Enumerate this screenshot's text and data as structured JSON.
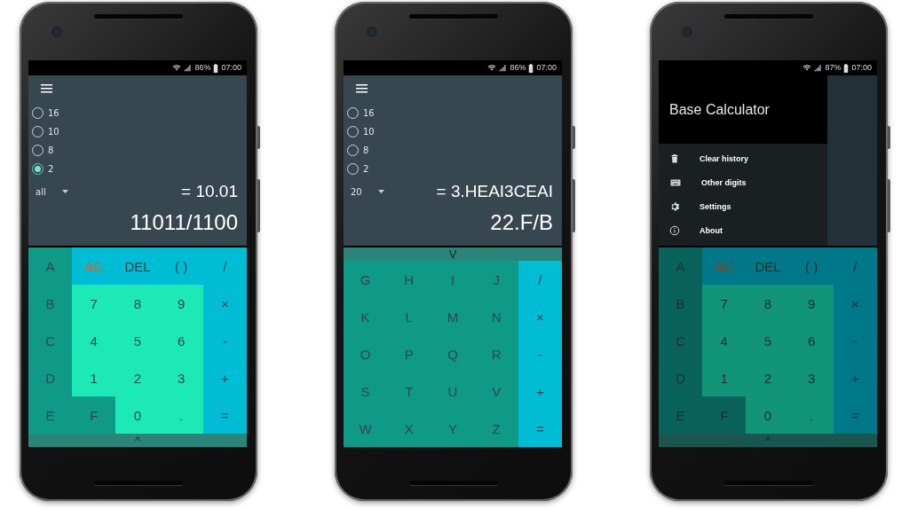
{
  "phones": [
    {
      "status": {
        "battery": "86%",
        "time": "07:00"
      },
      "calculator": {
        "radios": [
          {
            "label": "16",
            "selected": false
          },
          {
            "label": "10",
            "selected": false
          },
          {
            "label": "8",
            "selected": false
          },
          {
            "label": "2",
            "selected": true
          }
        ],
        "dropdown": "all",
        "result": "= 10.01",
        "expression": "11011/1100"
      },
      "keypad": {
        "toggle": "^",
        "kind": "digits",
        "rows": [
          [
            {
              "label": "A",
              "kind": "hex"
            },
            {
              "label": "AC",
              "kind": "clear"
            },
            {
              "label": "DEL",
              "kind": "func"
            },
            {
              "label": "( )",
              "kind": "func"
            },
            {
              "label": "/",
              "kind": "op"
            }
          ],
          [
            {
              "label": "B",
              "kind": "hex"
            },
            {
              "label": "7",
              "kind": "digit"
            },
            {
              "label": "8",
              "kind": "digit"
            },
            {
              "label": "9",
              "kind": "digit"
            },
            {
              "label": "×",
              "kind": "op"
            }
          ],
          [
            {
              "label": "C",
              "kind": "hex"
            },
            {
              "label": "4",
              "kind": "digit"
            },
            {
              "label": "5",
              "kind": "digit"
            },
            {
              "label": "6",
              "kind": "digit"
            },
            {
              "label": "-",
              "kind": "op"
            }
          ],
          [
            {
              "label": "D",
              "kind": "hex"
            },
            {
              "label": "1",
              "kind": "digit"
            },
            {
              "label": "2",
              "kind": "digit"
            },
            {
              "label": "3",
              "kind": "digit"
            },
            {
              "label": "+",
              "kind": "op"
            }
          ],
          [
            {
              "label": "E",
              "kind": "hex"
            },
            {
              "label": "F",
              "kind": "hex"
            },
            {
              "label": "0",
              "kind": "digit"
            },
            {
              "label": ".",
              "kind": "digit"
            },
            {
              "label": "=",
              "kind": "op"
            }
          ]
        ]
      }
    },
    {
      "status": {
        "battery": "86%",
        "time": "07:00"
      },
      "calculator": {
        "radios": [
          {
            "label": "16",
            "selected": false
          },
          {
            "label": "10",
            "selected": false
          },
          {
            "label": "8",
            "selected": false
          },
          {
            "label": "2",
            "selected": false
          }
        ],
        "dropdown": "20",
        "result": "= 3.HEAI3CEAI",
        "expression": "22.F/B"
      },
      "keypad": {
        "toggle": "V",
        "kind": "letters",
        "rows": [
          [
            {
              "label": "G",
              "kind": "hex"
            },
            {
              "label": "H",
              "kind": "hex"
            },
            {
              "label": "I",
              "kind": "hex"
            },
            {
              "label": "J",
              "kind": "hex"
            },
            {
              "label": "/",
              "kind": "op"
            }
          ],
          [
            {
              "label": "K",
              "kind": "hex"
            },
            {
              "label": "L",
              "kind": "hex"
            },
            {
              "label": "M",
              "kind": "hex"
            },
            {
              "label": "N",
              "kind": "hex"
            },
            {
              "label": "×",
              "kind": "op"
            }
          ],
          [
            {
              "label": "O",
              "kind": "hex"
            },
            {
              "label": "P",
              "kind": "hex"
            },
            {
              "label": "Q",
              "kind": "hex"
            },
            {
              "label": "R",
              "kind": "hex"
            },
            {
              "label": "-",
              "kind": "op"
            }
          ],
          [
            {
              "label": "S",
              "kind": "hex"
            },
            {
              "label": "T",
              "kind": "hex"
            },
            {
              "label": "U",
              "kind": "hex"
            },
            {
              "label": "V",
              "kind": "hex"
            },
            {
              "label": "+",
              "kind": "op"
            }
          ],
          [
            {
              "label": "W",
              "kind": "hex"
            },
            {
              "label": "X",
              "kind": "hex"
            },
            {
              "label": "Y",
              "kind": "hex"
            },
            {
              "label": "Z",
              "kind": "hex"
            },
            {
              "label": "=",
              "kind": "op"
            }
          ]
        ]
      }
    },
    {
      "status": {
        "battery": "87%",
        "time": "07:00"
      },
      "keypad": {
        "toggle": "^",
        "kind": "digits",
        "rows": [
          [
            {
              "label": "A",
              "kind": "hex"
            },
            {
              "label": "AC",
              "kind": "clear"
            },
            {
              "label": "DEL",
              "kind": "func"
            },
            {
              "label": "( )",
              "kind": "func"
            },
            {
              "label": "/",
              "kind": "op"
            }
          ],
          [
            {
              "label": "B",
              "kind": "hex"
            },
            {
              "label": "7",
              "kind": "digit"
            },
            {
              "label": "8",
              "kind": "digit"
            },
            {
              "label": "9",
              "kind": "digit"
            },
            {
              "label": "×",
              "kind": "op"
            }
          ],
          [
            {
              "label": "C",
              "kind": "hex"
            },
            {
              "label": "4",
              "kind": "digit"
            },
            {
              "label": "5",
              "kind": "digit"
            },
            {
              "label": "6",
              "kind": "digit"
            },
            {
              "label": "-",
              "kind": "op"
            }
          ],
          [
            {
              "label": "D",
              "kind": "hex"
            },
            {
              "label": "1",
              "kind": "digit"
            },
            {
              "label": "2",
              "kind": "digit"
            },
            {
              "label": "3",
              "kind": "digit"
            },
            {
              "label": "+",
              "kind": "op"
            }
          ],
          [
            {
              "label": "E",
              "kind": "hex"
            },
            {
              "label": "F",
              "kind": "hex"
            },
            {
              "label": "0",
              "kind": "digit"
            },
            {
              "label": ".",
              "kind": "digit"
            },
            {
              "label": "=",
              "kind": "op"
            }
          ]
        ]
      },
      "drawer": {
        "title": "Base Calculator",
        "items": [
          {
            "label": "Clear history"
          },
          {
            "label": "Other digits"
          },
          {
            "label": "Settings"
          },
          {
            "label": "About"
          }
        ]
      }
    }
  ]
}
